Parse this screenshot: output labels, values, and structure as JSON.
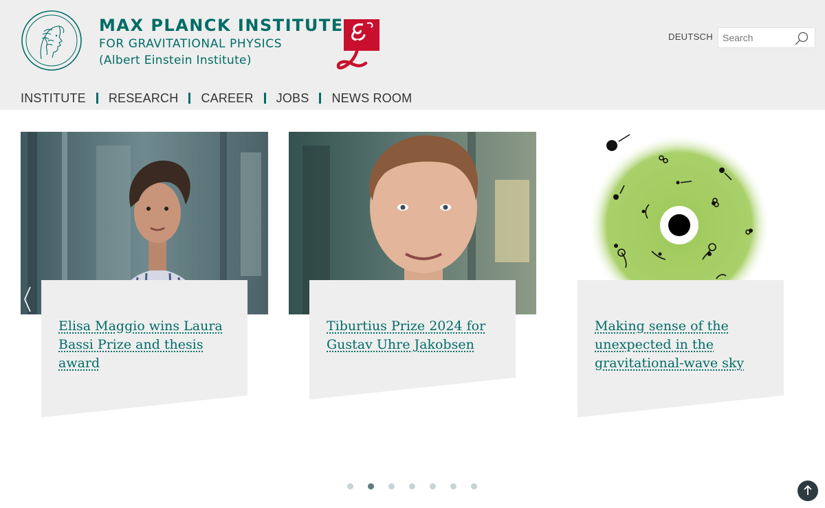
{
  "header": {
    "institute_line1": "MAX PLANCK INSTITUTE",
    "institute_line2": "FOR GRAVITATIONAL PHYSICS",
    "institute_line3": "(Albert Einstein Institute)",
    "seal_icon": "minerva-seal-icon",
    "aei_logo_icon": "aei-logo-icon",
    "language_link": "DEUTSCH",
    "search": {
      "placeholder": "Search",
      "value": "",
      "icon": "search-icon"
    }
  },
  "nav": {
    "items": [
      {
        "label": "INSTITUTE"
      },
      {
        "label": "RESEARCH"
      },
      {
        "label": "CAREER"
      },
      {
        "label": "JOBS"
      },
      {
        "label": "NEWS ROOM"
      }
    ]
  },
  "carousel": {
    "slides": [
      {
        "title": "Elisa Maggio wins Laura Bassi Prize and thesis award"
      },
      {
        "title": "Tiburtius Prize 2024 for Gustav Uhre Jakobsen"
      },
      {
        "title": "Making sense of the unexpected in the gravitational-wave sky"
      }
    ],
    "prev_icon": "chevron-left-icon",
    "dot_count": 7,
    "active_dot": 2
  },
  "back_to_top_icon": "arrow-up-icon",
  "colors": {
    "brand": "#006c66",
    "header_bg": "#eeeeee",
    "card_bg": "#eeeeee",
    "aei_red": "#c8102e"
  }
}
